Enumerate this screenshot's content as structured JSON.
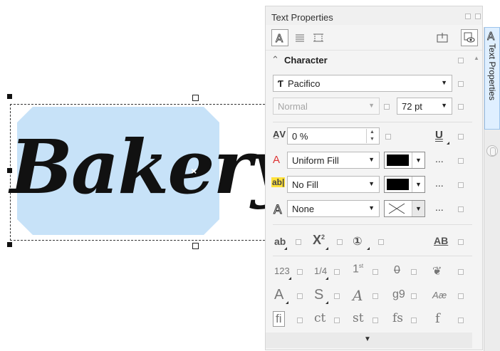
{
  "canvas": {
    "text": "Bakery",
    "shape_color": "#c7e2f8",
    "text_color": "#111111"
  },
  "docker": {
    "title": "Text Properties",
    "section_title": "Character",
    "font_name": "Pacifico",
    "font_style": "Normal",
    "font_size": "72 pt",
    "kerning": "0 %",
    "fill_type": "Uniform Fill",
    "fill_color": "#000000",
    "bg_fill_type": "No Fill",
    "bg_fill_color": "#000000",
    "outline": "None",
    "more_dots": "...",
    "glyph_labels": {
      "ab": "ab",
      "x2": "X",
      "sup2": "2",
      "circled1": "①",
      "ab_caps": "AB",
      "n123": "123",
      "quarter": "1/4",
      "first": "1",
      "first_sup": "st",
      "zero": "0",
      "A_alt": "A",
      "S_alt": "S",
      "A_script": "A",
      "g9": "g9",
      "Ae": "Aæ",
      "fi": "fi",
      "ct": "ct",
      "st": "st",
      "fs": "fs",
      "f": "f"
    }
  },
  "tabstrip": {
    "active_tab_label": "Text Properties"
  }
}
